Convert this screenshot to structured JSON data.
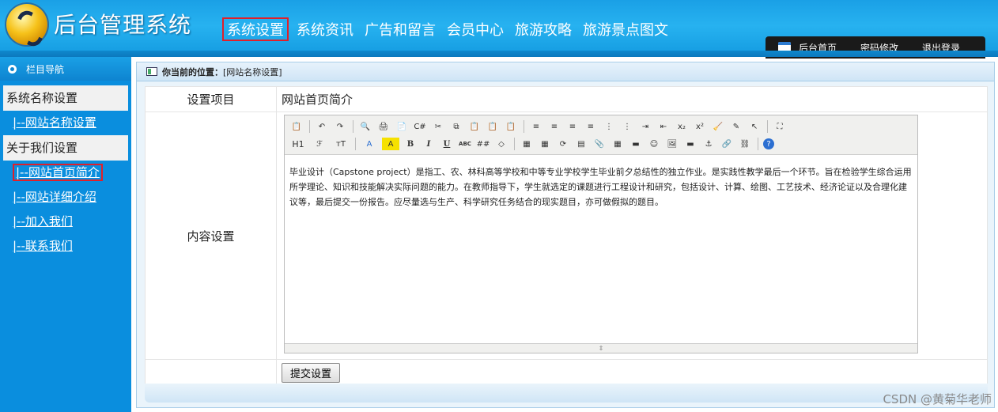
{
  "app": {
    "title": "后台管理系统"
  },
  "topnav": {
    "items": [
      "系统设置",
      "系统资讯",
      "广告和留言",
      "会员中心",
      "旅游攻略",
      "旅游景点图文"
    ]
  },
  "header_links": {
    "home": "后台首页",
    "password": "密码修改",
    "logout": "退出登录"
  },
  "sidebar": {
    "header": "栏目导航",
    "group1": "系统名称设置",
    "group1_links": [
      "|--网站名称设置"
    ],
    "group2": "关于我们设置",
    "group2_links": [
      "|--网站首页简介",
      "|--网站详细介绍",
      "|--加入我们",
      "|--联系我们"
    ]
  },
  "breadcrumb": {
    "label": "你当前的位置：",
    "value": "[网站名称设置]"
  },
  "form": {
    "setting_item_label": "设置项目",
    "setting_item_value": "网站首页简介",
    "content_label": "内容设置",
    "content_text": "毕业设计（Capstone project）是指工、农、林科高等学校和中等专业学校学生毕业前夕总结性的独立作业。是实践性教学最后一个环节。旨在检验学生综合运用所学理论、知识和技能解决实际问题的能力。在教师指导下，学生就选定的课题进行工程设计和研究，包括设计、计算、绘图、工艺技术、经济论证以及合理化建议等，最后提交一份报告。应尽量选与生产、科学研究任务结合的现实题目，亦可做假拟的题目。",
    "submit_label": "提交设置"
  },
  "editor_toolbar": {
    "row1": [
      "📋",
      "↶",
      "↷",
      "🔍",
      "🖨",
      "📄",
      "C#",
      "✂",
      "⧉",
      "📋",
      "📋",
      "📋",
      "≡",
      "≡",
      "≡",
      "≡",
      "⋮",
      "⋮",
      "⇥",
      "⇤",
      "x₂",
      "x²",
      "🧹",
      "✎",
      "↖",
      "⛶"
    ],
    "row2": [
      "H1",
      "ℱ",
      "тT",
      "A",
      "A",
      "B",
      "I",
      "U",
      "ABC",
      "##",
      "◇",
      "▦",
      "▦",
      "⟳",
      "▤",
      "📎",
      "▦",
      "▬",
      "☺",
      "🖼",
      "▬",
      "⚓",
      "🔗",
      "⛓",
      "?"
    ]
  },
  "watermark": "CSDN @黄菊华老师"
}
